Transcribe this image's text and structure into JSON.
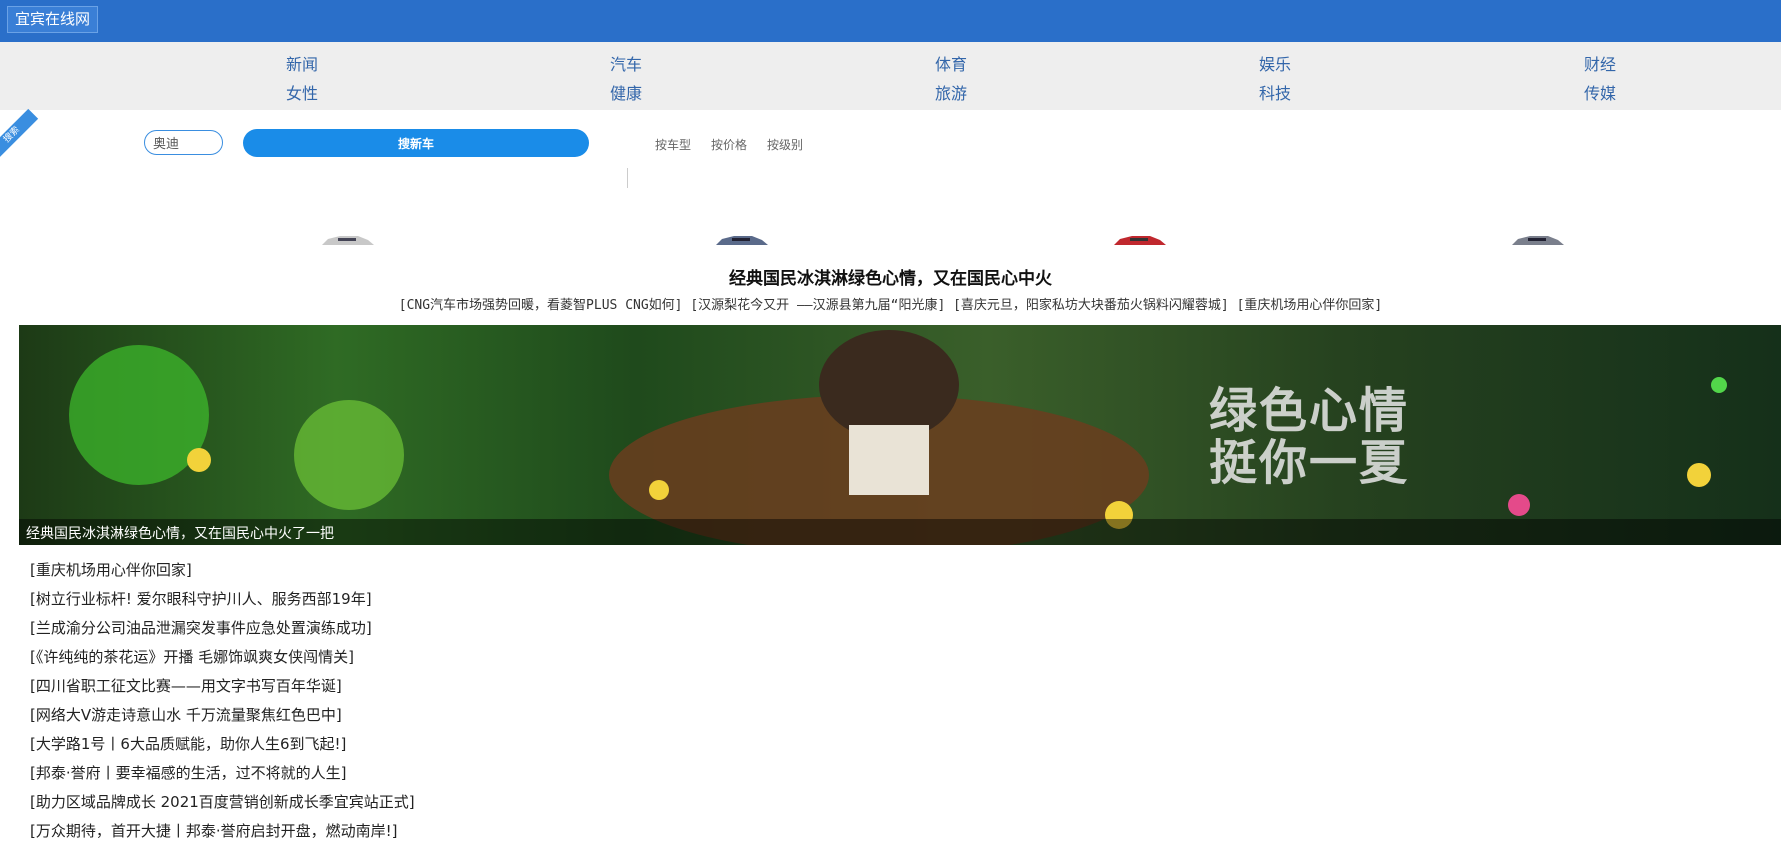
{
  "header": {
    "site_name": "宜宾在线网"
  },
  "nav": {
    "items": [
      {
        "label": "新闻"
      },
      {
        "label": "汽车"
      },
      {
        "label": "体育"
      },
      {
        "label": "娱乐"
      },
      {
        "label": "财经"
      },
      {
        "label": "女性"
      },
      {
        "label": "健康"
      },
      {
        "label": "旅游"
      },
      {
        "label": "科技"
      },
      {
        "label": "传媒"
      }
    ]
  },
  "search": {
    "ribbon": "搜索",
    "input_value": "奥迪",
    "button_label": "搜新车",
    "filters": [
      "按车型",
      "按价格",
      "按级别"
    ]
  },
  "cars": {
    "colors": [
      "#c8c8c8",
      "#5a6a8a",
      "#c0282e",
      "#7a7f8c"
    ]
  },
  "featured": {
    "headline": "经典国民冰淇淋绿色心情，又在国民心中火",
    "related": "[CNG汽车市场强势回暖，看菱智PLUS CNG如何] [汉源梨花今又开 ——汉源县第九届“阳光康] [喜庆元旦，阳家私坊大块番茄火锅料闪耀蓉城] [重庆机场用心伴你回家]",
    "banner_text_line1": "绿色心情",
    "banner_text_line2": "挺你一夏",
    "banner_caption": "经典国民冰淇淋绿色心情，又在国民心中火了一把"
  },
  "news": [
    "[重庆机场用心伴你回家]",
    "[树立行业标杆! 爱尔眼科守护川人、服务西部19年]",
    "[兰成渝分公司油品泄漏突发事件应急处置演练成功]",
    "[《许纯纯的茶花运》开播 毛娜饰飒爽女侠闯情关]",
    "[四川省职工征文比赛——用文字书写百年华诞]",
    "[网络大V游走诗意山水 千万流量聚焦红色巴中]",
    "[大学路1号丨6大品质赋能，助你人生6到飞起!]",
    "[邦泰·誉府丨要幸福感的生活，过不将就的人生]",
    "[助力区域品牌成长 2021百度营销创新成长季宜宾站正式]",
    "[万众期待，首开大捷丨邦泰·誉府启封开盘，燃动南岸!]"
  ]
}
